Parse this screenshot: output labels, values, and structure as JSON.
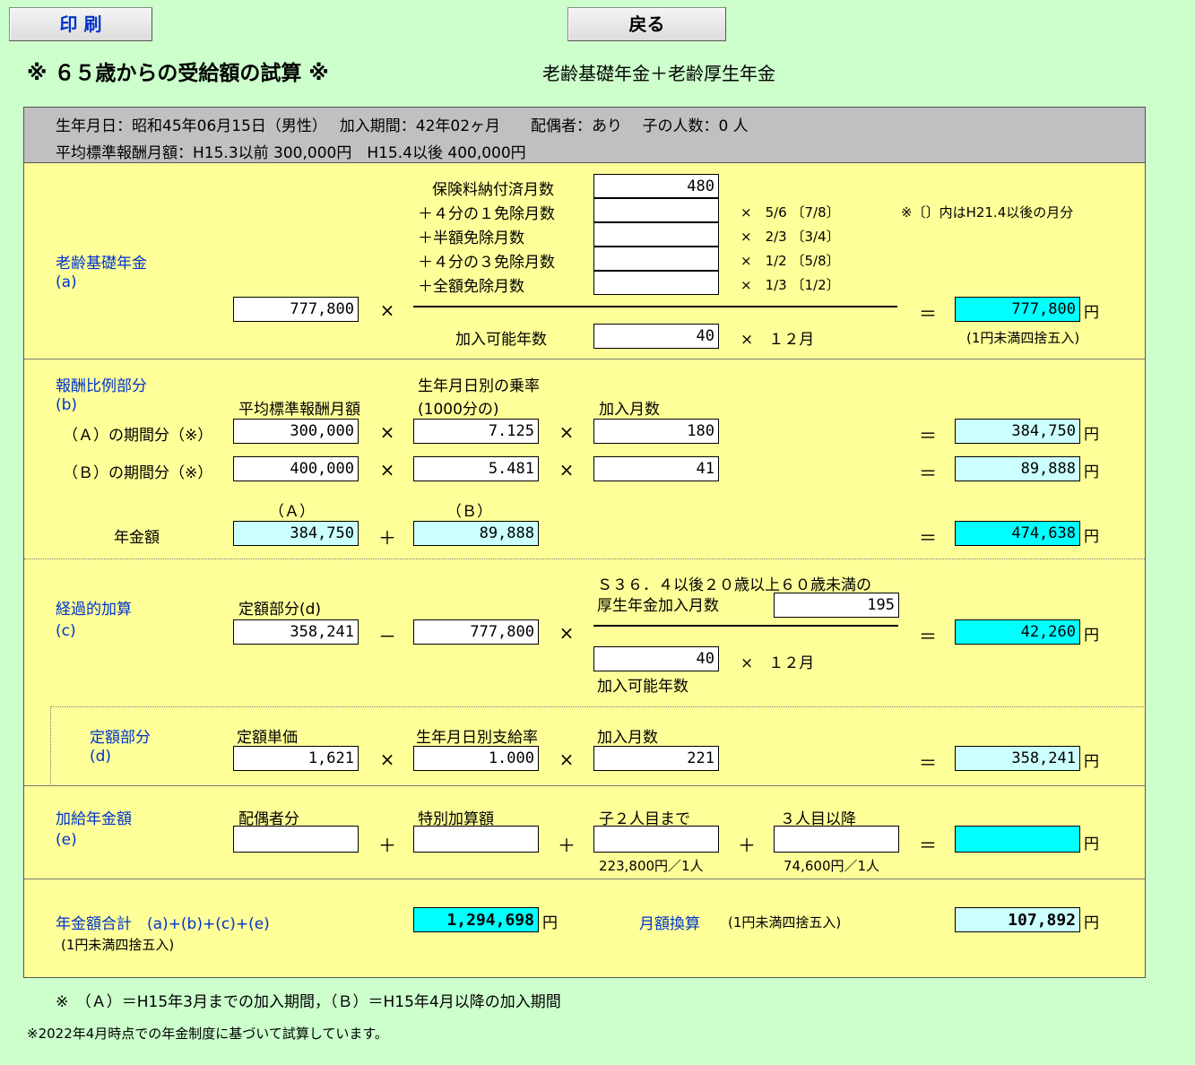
{
  "toolbar": {
    "print_label": "印 刷",
    "back_label": "戻る"
  },
  "title": "※ ６５歳からの受給額の試算 ※",
  "subtitle": "老齢基礎年金＋老齢厚生年金",
  "header": {
    "line1": "生年月日：昭和45年06月15日（男性）　 加入期間：42年02ヶ月　　配偶者：あり　 子の人数：0 人",
    "line2": "平均標準報酬月額：H15.3以前 300,000円　H15.4以後 400,000円"
  },
  "basic": {
    "label": "老齢基礎年金",
    "sub": "(a)",
    "months_labels": [
      "保険料納付済月数",
      "＋４分の１免除月数",
      "＋半額免除月数",
      "＋４分の３免除月数",
      "＋全額免除月数"
    ],
    "months_values": [
      "480",
      "",
      "",
      "",
      ""
    ],
    "ratios": [
      "×　5/6 〔7/8〕",
      "×　2/3 〔3/4〕",
      "×　1/2 〔5/8〕",
      "×　1/3 〔1/2〕"
    ],
    "note": "※〔〕内はH21.4以後の月分",
    "base": "777,800",
    "possible_years_label": "加入可能年数",
    "possible_years": "40",
    "months_12": "×　１２月",
    "result": "777,800",
    "rounding": "(1円未満四捨五入)"
  },
  "earnings": {
    "label": "報酬比例部分",
    "sub": "(b)",
    "col1": "平均標準報酬月額",
    "col2a": "生年月日別の乗率",
    "col2b": "(1000分の)",
    "col3": "加入月数",
    "rowA_label": "（Ａ）の期間分（※）",
    "rowB_label": "（Ｂ）の期間分（※）",
    "rowA": [
      "300,000",
      "7.125",
      "180",
      "384,750"
    ],
    "rowB": [
      "400,000",
      "5.481",
      "41",
      "89,888"
    ],
    "a_tag": "（Ａ）",
    "b_tag": "（Ｂ）",
    "total_label": "年金額",
    "sumA": "384,750",
    "sumB": "89,888",
    "total": "474,638"
  },
  "transition": {
    "label": "経過的加算",
    "sub": "(c)",
    "fixed_label": "定額部分(d)",
    "fixed": "358,241",
    "base": "777,800",
    "months_label1": "Ｓ３６．４以後２０歳以上６０歳未満の",
    "months_label2": "厚生年金加入月数",
    "months": "195",
    "years": "40",
    "months_12": "×　１２月",
    "years_label": "加入可能年数",
    "result": "42,260"
  },
  "fixed_part": {
    "label": "定額部分",
    "sub": "(d)",
    "unit_label": "定額単価",
    "rate_label": "生年月日別支給率",
    "months_label": "加入月数",
    "unit": "1,621",
    "rate": "1.000",
    "months": "221",
    "result": "358,241"
  },
  "addition": {
    "label": "加給年金額",
    "sub": "(e)",
    "spouse_label": "配偶者分",
    "special_label": "特別加算額",
    "child2_label": "子２人目まで",
    "child3_label": "３人目以降",
    "child2_note": "223,800円／1人",
    "child3_note": "74,600円／1人",
    "result": ""
  },
  "total": {
    "label": "年金額合計　(a)+(b)+(c)+(e)",
    "rounding": "(1円未満四捨五入)",
    "value": "1,294,698",
    "monthly_label": "月額換算",
    "monthly_rounding": "(1円未満四捨五入)",
    "monthly": "107,892"
  },
  "yen": "円",
  "ops": {
    "times": "×",
    "plus": "＋",
    "minus": "－",
    "eq": "＝"
  },
  "footnote1": "※　（Ａ）＝H15年3月までの加入期間，（Ｂ）＝H15年4月以降の加入期間",
  "footnote2": "※2022年4月時点での年金制度に基づいて試算しています。"
}
